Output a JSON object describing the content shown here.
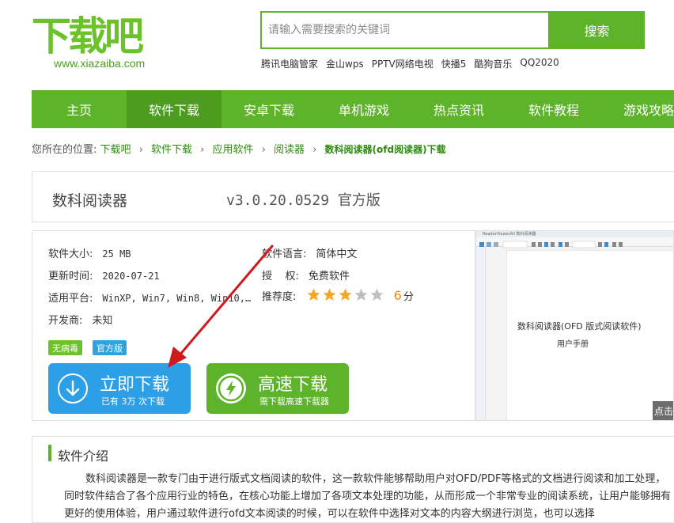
{
  "header": {
    "logo_text": "下载吧",
    "logo_url": "www.xiazaiba.com",
    "search_placeholder": "请输入需要搜索的关键词",
    "search_button": "搜索",
    "hot_links": [
      "腾讯电脑管家",
      "金山wps",
      "PPTV网络电视",
      "快播5",
      "酷狗音乐",
      "QQ2020"
    ]
  },
  "nav": {
    "items": [
      "主页",
      "软件下载",
      "安卓下载",
      "单机游戏",
      "热点资讯",
      "软件教程",
      "游戏攻略"
    ],
    "active_index": 1
  },
  "breadcrumb": {
    "prefix": "您所在的位置:",
    "links": [
      "下载吧",
      "软件下载",
      "应用软件",
      "阅读器"
    ],
    "current": "数科阅读器(ofd阅读器)下载",
    "separator": "›"
  },
  "software": {
    "name": "数科阅读器",
    "version": "v3.0.20.0529 官方版",
    "size_label": "软件大小:",
    "size_value": "25 MB",
    "update_label": "更新时间:",
    "update_value": "2020-07-21",
    "platform_label": "适用平台:",
    "platform_value": "WinXP, Win7, Win8, Win10,…",
    "developer_label": "开发商:",
    "developer_value": "未知",
    "language_label": "软件语言:",
    "language_value": "简体中文",
    "license_label": "授    权:",
    "license_value": "免费软件",
    "rating_label": "推荐度:",
    "rating_score": "6",
    "rating_unit": "分",
    "rating_stars": 3,
    "rating_max": 5,
    "tags": [
      "无病毒",
      "官方版"
    ]
  },
  "download": {
    "primary_title": "立即下载",
    "primary_sub": "已有 3万 次下载",
    "fast_title": "高速下载",
    "fast_sub": "需下载高速下载器"
  },
  "preview": {
    "window_title": "ReaderViewerAll  数科阅读器",
    "doc_title": "数科阅读器(OFD 版式阅读软件)",
    "doc_subtitle": "用户手册",
    "click_label": "点击"
  },
  "intro": {
    "heading": "软件介绍",
    "text": "数科阅读器是一款专门由于进行版式文档阅读的软件，这一款软件能够帮助用户对OFD/PDF等格式的文档进行阅读和加工处理，同时软件结合了各个应用行业的特色，在核心功能上增加了各项文本处理的功能，从而形成一个非常专业的阅读系统，让用户能够拥有更好的使用体验，用户通过软件进行ofd文本阅读的时候，可以在软件中选择对文本的内容大纲进行浏览，也可以选择"
  },
  "colors": {
    "brand_green": "#5db42a",
    "nav_active": "#4b9c1f",
    "download_blue": "#2d9fe6",
    "score_orange": "#f08a0e",
    "star_filled": "#f5a623",
    "star_empty": "#bfbfbf",
    "arrow_red": "#d0191c"
  }
}
